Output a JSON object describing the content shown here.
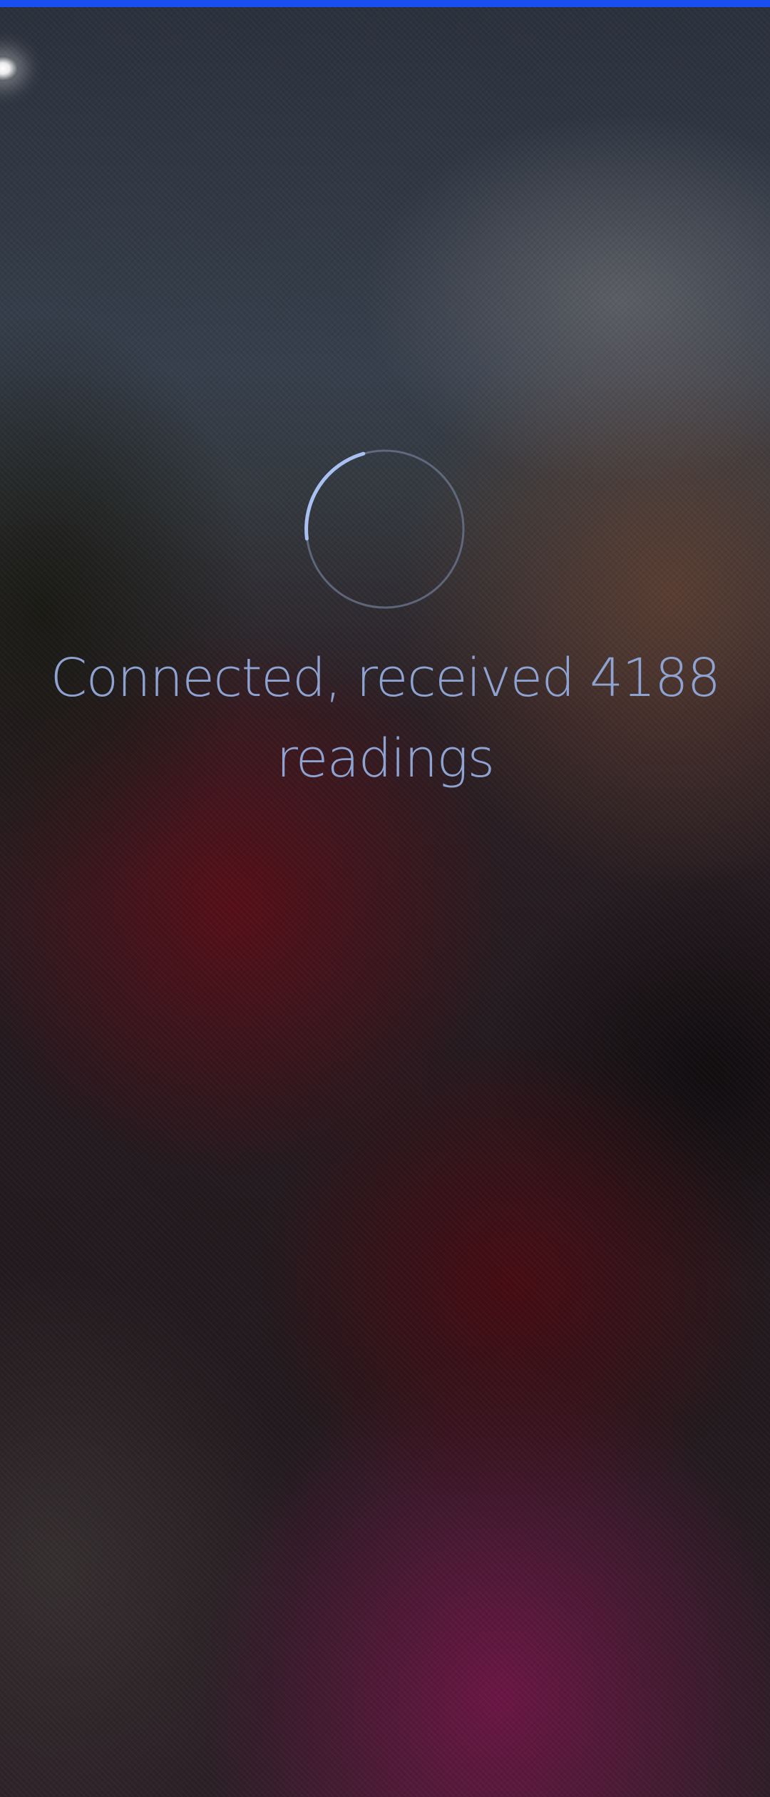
{
  "status": {
    "message": "Connected, received 4188 readings"
  },
  "busy_indicator": {
    "icon": "busy-spinner",
    "running": true
  },
  "colors": {
    "accent_bar": "#1a4ef0",
    "status_text": "#8ea3d1",
    "spinner_track": "#6e7891",
    "spinner_arc": "#a9c1f2"
  }
}
